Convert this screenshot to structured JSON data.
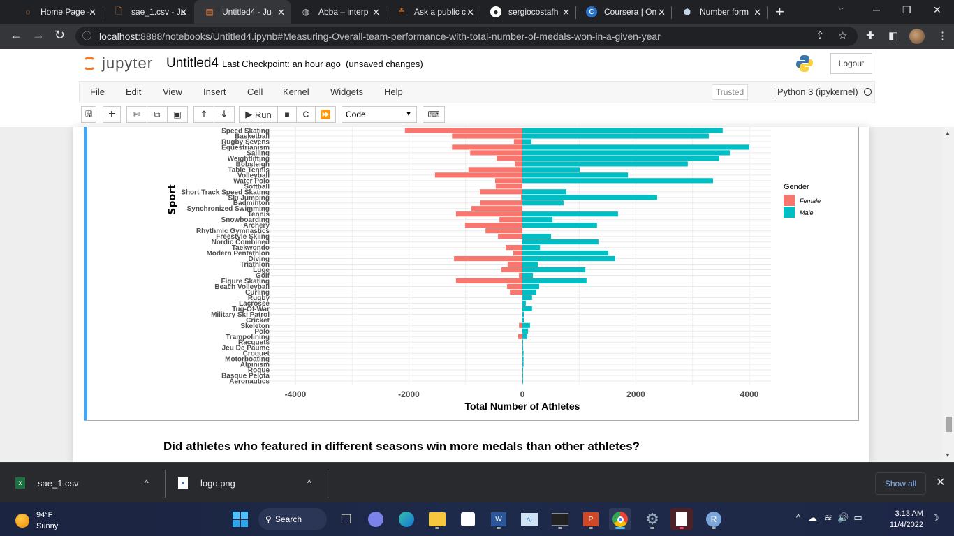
{
  "browser": {
    "tabs": [
      {
        "title": "Home Page - ",
        "icon": "jupyter-icon",
        "active": false
      },
      {
        "title": "sae_1.csv - Ju",
        "icon": "file-icon",
        "active": false
      },
      {
        "title": "Untitled4 - Ju",
        "icon": "notebook-icon",
        "active": true
      },
      {
        "title": "Abba – interp",
        "icon": "globe-icon",
        "active": false
      },
      {
        "title": "Ask a public c",
        "icon": "stackoverflow-icon",
        "active": false
      },
      {
        "title": "sergiocostafh",
        "icon": "github-icon",
        "active": false
      },
      {
        "title": "Coursera | On",
        "icon": "coursera-icon",
        "active": false
      },
      {
        "title": "Number form",
        "icon": "site-icon",
        "active": false
      }
    ],
    "new_tab": "+",
    "url_host": "localhost",
    "url_rest": ":8888/notebooks/Untitled4.ipynb#Measuring-Overall-team-performance-with-total-number-of-medals-won-in-a-given-year"
  },
  "jupyter": {
    "logo_text": "jupyter",
    "notebook_name": "Untitled4",
    "checkpoint": "Last Checkpoint: an hour ago",
    "unsaved": "(unsaved changes)",
    "logout": "Logout",
    "menu": [
      "File",
      "Edit",
      "View",
      "Insert",
      "Cell",
      "Kernel",
      "Widgets",
      "Help"
    ],
    "trusted": "Trusted",
    "kernel": "Python 3 (ipykernel)",
    "run_label": "Run",
    "cell_type": "Code"
  },
  "chart_data": {
    "type": "bar",
    "orientation": "horizontal-diverging",
    "xlabel": "Total Number of Athletes",
    "ylabel": "Sport",
    "xlim": [
      -4500,
      4500
    ],
    "xticks": [
      -4000,
      -2000,
      0,
      2000,
      4000
    ],
    "legend": {
      "title": "Gender",
      "position": "right",
      "entries": [
        "Female",
        "Male"
      ]
    },
    "colors": {
      "Female": "#f8766d",
      "Male": "#00bfc4"
    },
    "categories": [
      "Speed Skating",
      "Basketball",
      "Rugby Sevens",
      "Equestrianism",
      "Sailing",
      "Weightlifting",
      "Bobsleigh",
      "Table Tennis",
      "Volleyball",
      "Water Polo",
      "Softball",
      "Short Track Speed Skating",
      "Ski Jumping",
      "Badminton",
      "Synchronized Swimming",
      "Tennis",
      "Snowboarding",
      "Archery",
      "Rhythmic Gymnastics",
      "Freestyle Skiing",
      "Nordic Combined",
      "Taekwondo",
      "Modern Pentathlon",
      "Diving",
      "Triathlon",
      "Luge",
      "Golf",
      "Figure Skating",
      "Beach Volleyball",
      "Curling",
      "Rugby",
      "Lacrosse",
      "Tug-Of-War",
      "Military Ski Patrol",
      "Cricket",
      "Skeleton",
      "Polo",
      "Trampolining",
      "Racquets",
      "Jeu De Paume",
      "Croquet",
      "Motorboating",
      "Alpinism",
      "Roque",
      "Basque Pelota",
      "Aeronautics"
    ],
    "series": [
      {
        "name": "Female",
        "values": [
          -2070,
          -1240,
          -150,
          -1240,
          -920,
          -455,
          -135,
          -950,
          -1540,
          -480,
          -470,
          -750,
          -25,
          -740,
          -900,
          -1170,
          -405,
          -1010,
          -650,
          -430,
          0,
          -295,
          -160,
          -1205,
          -260,
          -370,
          -60,
          -1170,
          -270,
          -220,
          0,
          0,
          0,
          0,
          0,
          -60,
          0,
          -75,
          0,
          0,
          0,
          0,
          0,
          0,
          0,
          0
        ]
      },
      {
        "name": "Male",
        "values": [
          3530,
          3285,
          160,
          4000,
          3655,
          3470,
          2915,
          1010,
          1860,
          3360,
          0,
          775,
          2375,
          725,
          0,
          1685,
          530,
          1315,
          0,
          505,
          1340,
          310,
          1515,
          1635,
          270,
          1110,
          185,
          1130,
          295,
          245,
          170,
          60,
          170,
          25,
          25,
          135,
          100,
          85,
          10,
          10,
          20,
          20,
          20,
          10,
          10,
          10
        ]
      }
    ]
  },
  "next_heading": "Did athletes who featured in different seasons win more medals than other athletes?",
  "downloads": [
    {
      "name": "sae_1.csv",
      "icon": "excel-csv-icon"
    },
    {
      "name": "logo.png",
      "icon": "image-file-icon"
    }
  ],
  "downloads_show_all": "Show all",
  "taskbar": {
    "weather_temp": "94°F",
    "weather_desc": "Sunny",
    "search": "Search",
    "time": "3:13 AM",
    "date": "11/4/2022"
  }
}
